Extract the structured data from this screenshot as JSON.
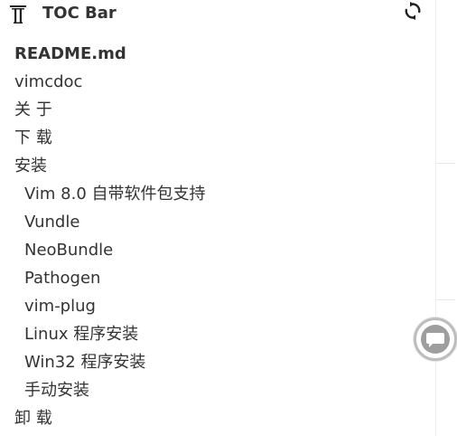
{
  "header": {
    "title": "TOC Bar",
    "toc_icon": "toc-icon",
    "refresh_icon": "refresh-icon"
  },
  "toc": {
    "items": [
      {
        "label": "README.md",
        "level": 1,
        "bold": true
      },
      {
        "label": "vimcdoc",
        "level": 1,
        "bold": false
      },
      {
        "label": "关 于",
        "level": 1,
        "bold": false
      },
      {
        "label": "下 载",
        "level": 1,
        "bold": false
      },
      {
        "label": "安装",
        "level": 1,
        "bold": false
      },
      {
        "label": "Vim 8.0 自带软件包支持",
        "level": 2,
        "bold": false
      },
      {
        "label": "Vundle",
        "level": 2,
        "bold": false
      },
      {
        "label": "NeoBundle",
        "level": 2,
        "bold": false
      },
      {
        "label": "Pathogen",
        "level": 2,
        "bold": false
      },
      {
        "label": "vim-plug",
        "level": 2,
        "bold": false
      },
      {
        "label": "Linux 程序安装",
        "level": 2,
        "bold": false
      },
      {
        "label": "Win32 程序安装",
        "level": 2,
        "bold": false
      },
      {
        "label": "手动安装",
        "level": 2,
        "bold": false
      },
      {
        "label": "卸 载",
        "level": 1,
        "bold": false
      }
    ]
  },
  "floating_button": {
    "icon": "chat-bubble-icon"
  },
  "colors": {
    "text": "#333333",
    "background": "#ffffff",
    "fab_border": "#bdbdbd",
    "fab_fill": "#a0a0a0"
  }
}
